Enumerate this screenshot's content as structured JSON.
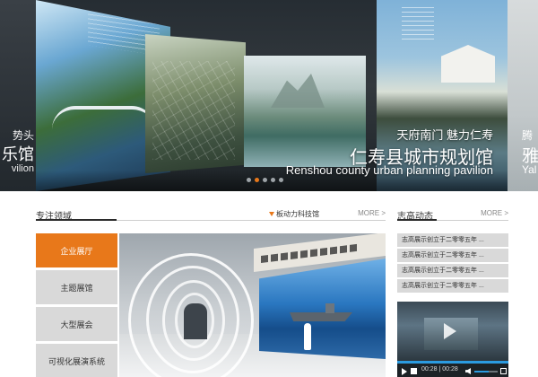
{
  "banner": {
    "prev_slide": {
      "line1": "势头",
      "line2": "乐馆",
      "line3": "vilion"
    },
    "main_slide": {
      "slogan": "天府南门 魅力仁寿",
      "title_cn": "仁寿县城市规划馆",
      "title_en": "Renshou county urban planning pavilion"
    },
    "next_slide": {
      "line1": "腾",
      "line2": "雅",
      "line3": "Yal"
    },
    "dots": [
      {
        "active": false
      },
      {
        "active": true
      },
      {
        "active": false
      },
      {
        "active": false
      },
      {
        "active": false
      }
    ],
    "colors": {
      "accent": "#e8781a",
      "dot": "#9ea4a8"
    }
  },
  "focus_section": {
    "title": "专注领域",
    "subtitle": "板动力科技馆",
    "more": "MORE >",
    "menu": [
      {
        "label": "企业展厅",
        "active": true
      },
      {
        "label": "主题展馆",
        "active": false
      },
      {
        "label": "大型展会",
        "active": false
      },
      {
        "label": "可视化展演系统",
        "active": false
      }
    ]
  },
  "news_section": {
    "title": "志高动态",
    "more": "MORE >",
    "items": [
      "志高展示创立于二零零五年 ...",
      "志高展示创立于二零零五年 ...",
      "志高展示创立于二零零五年 ...",
      "志高展示创立于二零零五年 ..."
    ]
  },
  "video": {
    "time": "00:28 | 00:28",
    "progress": 1.0,
    "volume": 0.6,
    "icons": {
      "play": "play-icon",
      "stop": "stop-icon",
      "volume": "volume-icon",
      "fullscreen": "fullscreen-icon"
    }
  }
}
